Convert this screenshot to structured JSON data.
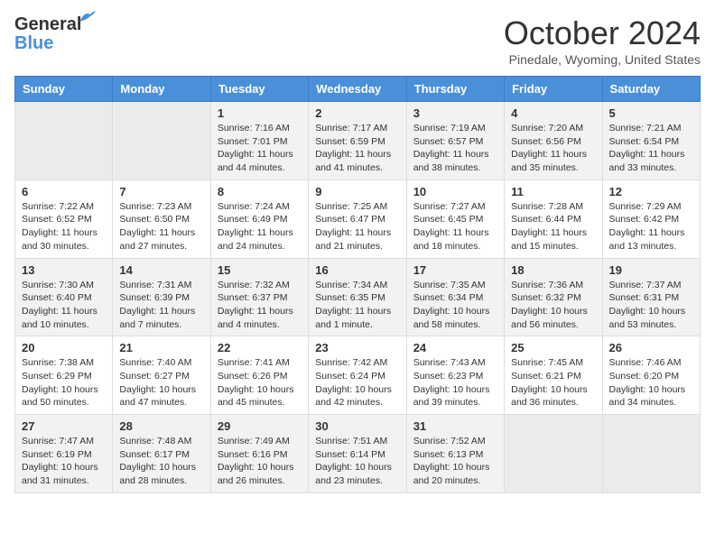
{
  "header": {
    "logo_line1": "General",
    "logo_line2": "Blue",
    "month": "October 2024",
    "location": "Pinedale, Wyoming, United States"
  },
  "weekdays": [
    "Sunday",
    "Monday",
    "Tuesday",
    "Wednesday",
    "Thursday",
    "Friday",
    "Saturday"
  ],
  "weeks": [
    [
      {
        "day": "",
        "info": ""
      },
      {
        "day": "",
        "info": ""
      },
      {
        "day": "1",
        "info": "Sunrise: 7:16 AM\nSunset: 7:01 PM\nDaylight: 11 hours and 44 minutes."
      },
      {
        "day": "2",
        "info": "Sunrise: 7:17 AM\nSunset: 6:59 PM\nDaylight: 11 hours and 41 minutes."
      },
      {
        "day": "3",
        "info": "Sunrise: 7:19 AM\nSunset: 6:57 PM\nDaylight: 11 hours and 38 minutes."
      },
      {
        "day": "4",
        "info": "Sunrise: 7:20 AM\nSunset: 6:56 PM\nDaylight: 11 hours and 35 minutes."
      },
      {
        "day": "5",
        "info": "Sunrise: 7:21 AM\nSunset: 6:54 PM\nDaylight: 11 hours and 33 minutes."
      }
    ],
    [
      {
        "day": "6",
        "info": "Sunrise: 7:22 AM\nSunset: 6:52 PM\nDaylight: 11 hours and 30 minutes."
      },
      {
        "day": "7",
        "info": "Sunrise: 7:23 AM\nSunset: 6:50 PM\nDaylight: 11 hours and 27 minutes."
      },
      {
        "day": "8",
        "info": "Sunrise: 7:24 AM\nSunset: 6:49 PM\nDaylight: 11 hours and 24 minutes."
      },
      {
        "day": "9",
        "info": "Sunrise: 7:25 AM\nSunset: 6:47 PM\nDaylight: 11 hours and 21 minutes."
      },
      {
        "day": "10",
        "info": "Sunrise: 7:27 AM\nSunset: 6:45 PM\nDaylight: 11 hours and 18 minutes."
      },
      {
        "day": "11",
        "info": "Sunrise: 7:28 AM\nSunset: 6:44 PM\nDaylight: 11 hours and 15 minutes."
      },
      {
        "day": "12",
        "info": "Sunrise: 7:29 AM\nSunset: 6:42 PM\nDaylight: 11 hours and 13 minutes."
      }
    ],
    [
      {
        "day": "13",
        "info": "Sunrise: 7:30 AM\nSunset: 6:40 PM\nDaylight: 11 hours and 10 minutes."
      },
      {
        "day": "14",
        "info": "Sunrise: 7:31 AM\nSunset: 6:39 PM\nDaylight: 11 hours and 7 minutes."
      },
      {
        "day": "15",
        "info": "Sunrise: 7:32 AM\nSunset: 6:37 PM\nDaylight: 11 hours and 4 minutes."
      },
      {
        "day": "16",
        "info": "Sunrise: 7:34 AM\nSunset: 6:35 PM\nDaylight: 11 hours and 1 minute."
      },
      {
        "day": "17",
        "info": "Sunrise: 7:35 AM\nSunset: 6:34 PM\nDaylight: 10 hours and 58 minutes."
      },
      {
        "day": "18",
        "info": "Sunrise: 7:36 AM\nSunset: 6:32 PM\nDaylight: 10 hours and 56 minutes."
      },
      {
        "day": "19",
        "info": "Sunrise: 7:37 AM\nSunset: 6:31 PM\nDaylight: 10 hours and 53 minutes."
      }
    ],
    [
      {
        "day": "20",
        "info": "Sunrise: 7:38 AM\nSunset: 6:29 PM\nDaylight: 10 hours and 50 minutes."
      },
      {
        "day": "21",
        "info": "Sunrise: 7:40 AM\nSunset: 6:27 PM\nDaylight: 10 hours and 47 minutes."
      },
      {
        "day": "22",
        "info": "Sunrise: 7:41 AM\nSunset: 6:26 PM\nDaylight: 10 hours and 45 minutes."
      },
      {
        "day": "23",
        "info": "Sunrise: 7:42 AM\nSunset: 6:24 PM\nDaylight: 10 hours and 42 minutes."
      },
      {
        "day": "24",
        "info": "Sunrise: 7:43 AM\nSunset: 6:23 PM\nDaylight: 10 hours and 39 minutes."
      },
      {
        "day": "25",
        "info": "Sunrise: 7:45 AM\nSunset: 6:21 PM\nDaylight: 10 hours and 36 minutes."
      },
      {
        "day": "26",
        "info": "Sunrise: 7:46 AM\nSunset: 6:20 PM\nDaylight: 10 hours and 34 minutes."
      }
    ],
    [
      {
        "day": "27",
        "info": "Sunrise: 7:47 AM\nSunset: 6:19 PM\nDaylight: 10 hours and 31 minutes."
      },
      {
        "day": "28",
        "info": "Sunrise: 7:48 AM\nSunset: 6:17 PM\nDaylight: 10 hours and 28 minutes."
      },
      {
        "day": "29",
        "info": "Sunrise: 7:49 AM\nSunset: 6:16 PM\nDaylight: 10 hours and 26 minutes."
      },
      {
        "day": "30",
        "info": "Sunrise: 7:51 AM\nSunset: 6:14 PM\nDaylight: 10 hours and 23 minutes."
      },
      {
        "day": "31",
        "info": "Sunrise: 7:52 AM\nSunset: 6:13 PM\nDaylight: 10 hours and 20 minutes."
      },
      {
        "day": "",
        "info": ""
      },
      {
        "day": "",
        "info": ""
      }
    ]
  ]
}
